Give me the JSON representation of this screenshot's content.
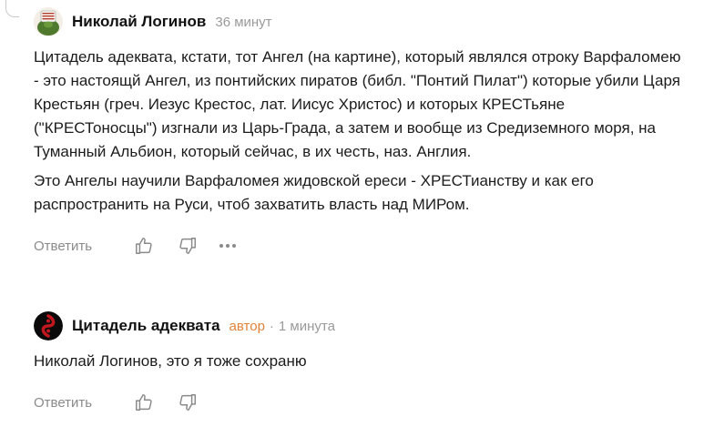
{
  "comments": [
    {
      "author": "Николай Логинов",
      "time": "36 минут",
      "paragraphs": [
        "Цитадель адеквата, кстати, тот Ангел (на картине), который являлся отроку Варфаломею - это настоящй Ангел, из понтийских пиратов (библ. \"Понтий Пилат\") которые убили Царя Крестьян (греч. Иезус Крестос, лат. Иисус Христос) и которых КРЕСТьяне (\"КРЕСТоносцы\") изгнали из Царь-Града, а затем и вообще из Средиземного моря, на Туманный Альбион, который сейчас, в их честь, наз. Англия.",
        "Это Ангелы научили Варфаломея жидовской ереси - ХРЕСТианству и как его распространить на Руси, чтоб захватить власть над МИРом."
      ],
      "reply_label": "Ответить"
    },
    {
      "author": "Цитадель адеквата",
      "badge": "автор",
      "separator": "·",
      "time": "1 минута",
      "paragraphs": [
        "Николай Логинов, это я тоже сохраню"
      ],
      "reply_label": "Ответить"
    }
  ],
  "icons": {
    "like": "thumbs-up-icon",
    "dislike": "thumbs-down-icon",
    "more": "more-dots-icon"
  },
  "colors": {
    "badge": "#e0843a",
    "muted": "#9a9a9a",
    "action": "#8a8a8a"
  }
}
